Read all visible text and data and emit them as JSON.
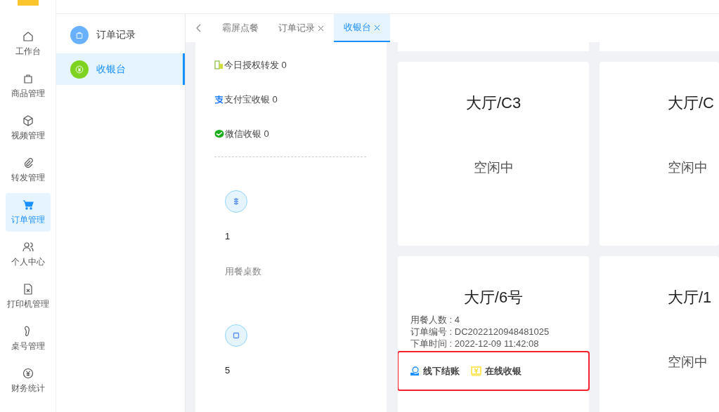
{
  "nav": {
    "items": [
      {
        "label": "工作台",
        "kind": "home",
        "selected": false
      },
      {
        "label": "商品管理",
        "kind": "bag",
        "selected": false
      },
      {
        "label": "视频管理",
        "kind": "cube",
        "selected": false
      },
      {
        "label": "转发管理",
        "kind": "clip",
        "selected": false
      },
      {
        "label": "订单管理",
        "kind": "cart",
        "selected": true
      },
      {
        "label": "个人中心",
        "kind": "people",
        "selected": false
      },
      {
        "label": "打印机管理",
        "kind": "file",
        "selected": false
      },
      {
        "label": "桌号管理",
        "kind": "foot",
        "selected": false
      },
      {
        "label": "财务统计",
        "kind": "yen",
        "selected": false
      }
    ]
  },
  "submenu": {
    "items": [
      {
        "label": "订单记录",
        "kind": "bag",
        "selected": false
      },
      {
        "label": "收银台",
        "kind": "yen",
        "selected": true
      }
    ]
  },
  "tabs": [
    {
      "label": "霸屏点餐",
      "closable": false,
      "selected": false
    },
    {
      "label": "订单记录",
      "closable": true,
      "selected": false
    },
    {
      "label": "收银台",
      "closable": true,
      "selected": true
    }
  ],
  "stats": {
    "payments": [
      {
        "kind": "auth",
        "label": "今日授权转发 0"
      },
      {
        "kind": "alipay",
        "label": "支付宝收银 0"
      },
      {
        "kind": "wechat",
        "label": "微信收银 0"
      }
    ],
    "counters": [
      {
        "kind": "dining",
        "value": "1",
        "label": "用餐桌数"
      },
      {
        "kind": "free",
        "value": "5"
      }
    ]
  },
  "tables": [
    {
      "name": "大厅/C3",
      "status": "空闲中"
    },
    {
      "name": "大厅/C",
      "status": "空闲中"
    },
    {
      "name": "大厅/6号",
      "details": [
        "用餐人数 : 4",
        "订单编号 : DC2022120948481025",
        "下单时间 : 2022-12-09 11:42:08"
      ],
      "actions": [
        {
          "kind": "offline",
          "label": "线下结账"
        },
        {
          "kind": "online",
          "label": "在线收银"
        }
      ]
    },
    {
      "name": "大厅/1",
      "status": "空闲中"
    }
  ]
}
